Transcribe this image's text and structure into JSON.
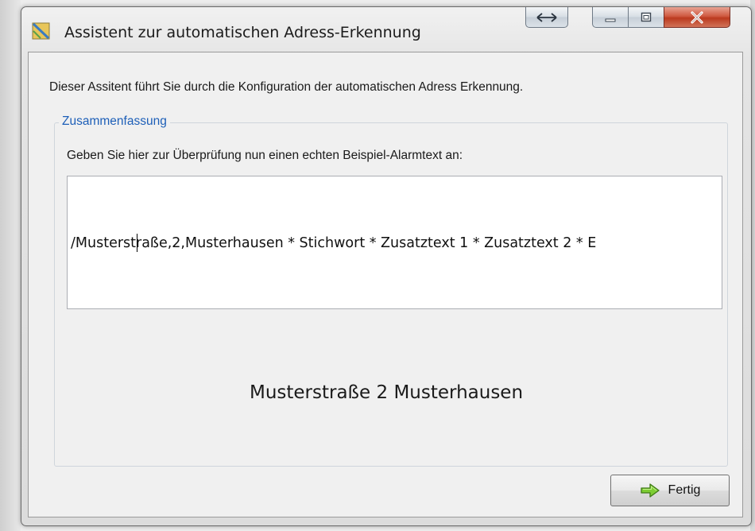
{
  "window": {
    "title": "Assistent zur automatischen Adress-Erkennung"
  },
  "intro_text": "Dieser Assitent führt Sie durch die Konfiguration der automatischen Adress Erkennung.",
  "group": {
    "title": "Zusammenfassung",
    "instruction": "Geben Sie hier zur Überprüfung nun einen echten Beispiel-Alarmtext an:"
  },
  "sample_input": {
    "value": "/Musterstraße,2,Musterhausen * Stichwort * Zusatztext 1 * Zusatztext 2 * E"
  },
  "result_text": "Musterstraße 2 Musterhausen",
  "finish_button": {
    "label": "Fertig",
    "icon": "green-arrow-right-icon"
  },
  "titlebar_buttons": [
    "resize-icon",
    "minimize-icon",
    "maximize-icon",
    "close-icon"
  ],
  "colors": {
    "group_title": "#1d5fb8",
    "close_button": "#c8472c",
    "arrow_green": "#6abf2b"
  }
}
